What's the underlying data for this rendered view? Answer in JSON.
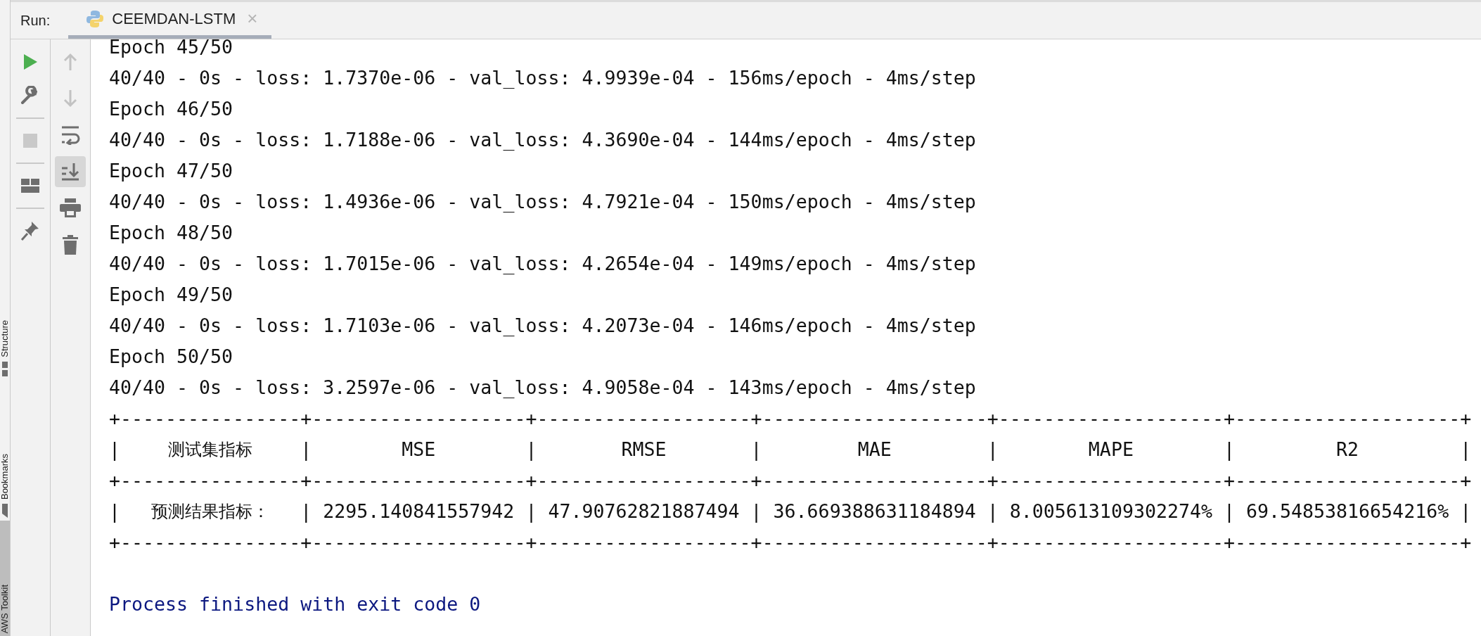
{
  "side_strip": [
    {
      "label": "Structure",
      "kind": "structure",
      "selected": false
    },
    {
      "label": "Bookmarks",
      "kind": "bookmarks",
      "selected": false
    },
    {
      "label": "AWS Toolkit",
      "kind": "aws",
      "selected": true
    }
  ],
  "run_bar": {
    "label": "Run:",
    "tab": {
      "title": "CEEMDAN-LSTM",
      "close": "×",
      "selected": true
    }
  },
  "left_toolbar": [
    {
      "kind": "run",
      "disabled": false
    },
    {
      "kind": "settings",
      "disabled": false
    },
    {
      "kind": "separator"
    },
    {
      "kind": "stop",
      "disabled": true
    },
    {
      "kind": "separator"
    },
    {
      "kind": "layout",
      "disabled": false
    },
    {
      "kind": "separator"
    },
    {
      "kind": "pin",
      "disabled": false
    }
  ],
  "console_toolbar": [
    {
      "kind": "up",
      "disabled": true,
      "on": false
    },
    {
      "kind": "down",
      "disabled": true,
      "on": false
    },
    {
      "kind": "wrap",
      "disabled": false,
      "on": false
    },
    {
      "kind": "scroll_end",
      "disabled": false,
      "on": true
    },
    {
      "kind": "print",
      "disabled": false,
      "on": false
    },
    {
      "kind": "trash",
      "disabled": false,
      "on": false
    }
  ],
  "console": [
    {
      "kind": "text",
      "text": "Epoch 45/50"
    },
    {
      "kind": "text",
      "text": "40/40 - 0s - loss: 1.7370e-06 - val_loss: 4.9939e-04 - 156ms/epoch - 4ms/step"
    },
    {
      "kind": "text",
      "text": "Epoch 46/50"
    },
    {
      "kind": "text",
      "text": "40/40 - 0s - loss: 1.7188e-06 - val_loss: 4.3690e-04 - 144ms/epoch - 4ms/step"
    },
    {
      "kind": "text",
      "text": "Epoch 47/50"
    },
    {
      "kind": "text",
      "text": "40/40 - 0s - loss: 1.4936e-06 - val_loss: 4.7921e-04 - 150ms/epoch - 4ms/step"
    },
    {
      "kind": "text",
      "text": "Epoch 48/50"
    },
    {
      "kind": "text",
      "text": "40/40 - 0s - loss: 1.7015e-06 - val_loss: 4.2654e-04 - 149ms/epoch - 4ms/step"
    },
    {
      "kind": "text",
      "text": "Epoch 49/50"
    },
    {
      "kind": "text",
      "text": "40/40 - 0s - loss: 1.7103e-06 - val_loss: 4.2073e-04 - 146ms/epoch - 4ms/step"
    },
    {
      "kind": "text",
      "text": "Epoch 50/50"
    },
    {
      "kind": "text",
      "text": "40/40 - 0s - loss: 3.2597e-06 - val_loss: 4.9058e-04 - 143ms/epoch - 4ms/step"
    },
    {
      "kind": "rule",
      "text": "+----------------+-------------------+-------------------+--------------------+--------------------+--------------------+"
    },
    {
      "kind": "header",
      "parts": [
        "|",
        "测试集指标",
        "|",
        "MSE",
        "|",
        "RMSE",
        "|",
        "MAE",
        "|",
        "MAPE",
        "|",
        "R2",
        "|"
      ]
    },
    {
      "kind": "rule",
      "text": "+----------------+-------------------+-------------------+--------------------+--------------------+--------------------+"
    },
    {
      "kind": "row",
      "parts": [
        "|",
        "预测结果指标：",
        "|",
        "2295.140841557942",
        "|",
        "47.90762821887494",
        "|",
        "36.669388631184894",
        "|",
        "8.005613109302274%",
        "|",
        "69.54853816654216%",
        "|"
      ]
    },
    {
      "kind": "rule",
      "text": "+----------------+-------------------+-------------------+--------------------+--------------------+--------------------+"
    },
    {
      "kind": "blank"
    },
    {
      "kind": "exit",
      "text": "Process finished with exit code 0"
    }
  ]
}
